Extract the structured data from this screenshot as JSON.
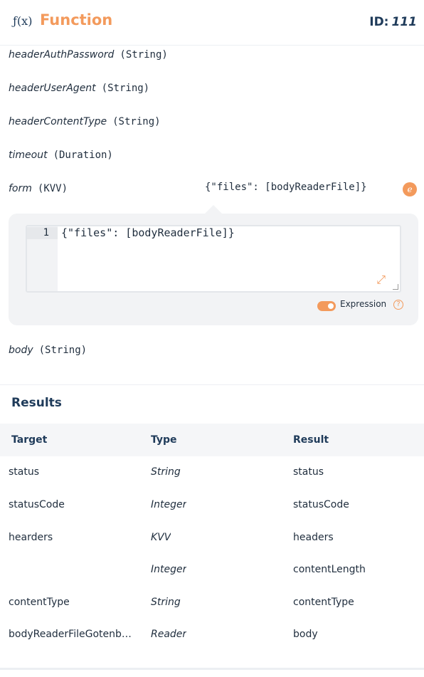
{
  "header": {
    "icon_text": "ƒ(x)",
    "title": "Function",
    "id_label": "ID:",
    "id_value": "111"
  },
  "params": [
    {
      "name": "headerAuthPassword",
      "type": "(String)"
    },
    {
      "name": "headerUserAgent",
      "type": "(String)"
    },
    {
      "name": "headerContentType",
      "type": "(String)"
    },
    {
      "name": "timeout",
      "type": "(Duration)"
    },
    {
      "name": "form",
      "type": "(KVV)"
    },
    {
      "name": "body",
      "type": "(String)"
    }
  ],
  "form_value": "{\"files\": [bodyReaderFile]}",
  "expression_badge": "e",
  "editor": {
    "line_number": "1",
    "code": "{\"files\": [bodyReaderFile]}"
  },
  "expression_toggle": {
    "label": "Expression",
    "enabled": true,
    "help": "?"
  },
  "results": {
    "title": "Results",
    "columns": [
      "Target",
      "Type",
      "Result"
    ],
    "rows": [
      {
        "target": "status",
        "type": "String",
        "result": "status"
      },
      {
        "target": "statusCode",
        "type": "Integer",
        "result": "statusCode"
      },
      {
        "target": "hearders",
        "type": "KVV",
        "result": "headers"
      },
      {
        "target": "",
        "type": "Integer",
        "result": "contentLength"
      },
      {
        "target": "contentType",
        "type": "String",
        "result": "contentType"
      },
      {
        "target": "bodyReaderFileGotenb…",
        "type": "Reader",
        "result": "body"
      }
    ]
  },
  "colors": {
    "accent": "#f39a5c",
    "primary_text": "#1f3b5a"
  }
}
